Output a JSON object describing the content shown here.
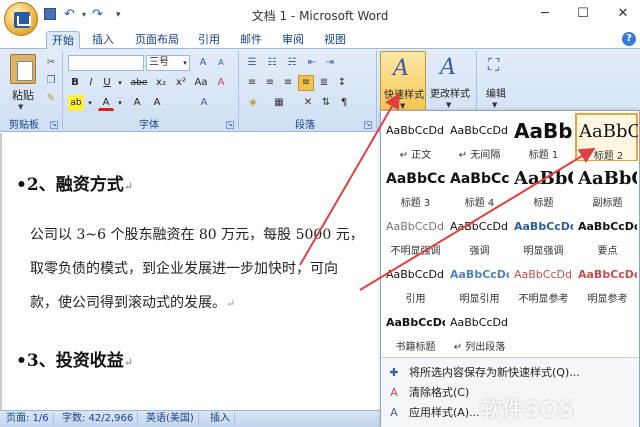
{
  "window": {
    "title": "文档 1 - Microsoft Word",
    "min": "─",
    "max": "☐",
    "close": "✕"
  },
  "qat": {
    "undo": "↶",
    "redo": "↷",
    "more": "▾",
    "undo_dd": "▾"
  },
  "tabs": [
    "开始",
    "插入",
    "页面布局",
    "引用",
    "邮件",
    "审阅",
    "视图"
  ],
  "ribbon": {
    "clipboard": {
      "label": "剪贴板",
      "paste": "粘贴"
    },
    "font": {
      "label": "字体",
      "font_name": "",
      "font_size": "三号",
      "bold": "B",
      "italic": "I",
      "underline": "U",
      "strike": "abe",
      "sub": "x₂",
      "sup": "x²",
      "aa": "Aa",
      "clear": "A",
      "grow": "A",
      "shrink": "A",
      "size_dd": "▾",
      "wen": "A"
    },
    "paragraph": {
      "label": "段落"
    },
    "styles": {
      "quick_styles": "快速样式",
      "change_styles": "更改样式"
    },
    "editing": {
      "label": "编辑"
    }
  },
  "document": {
    "heading2": "•2、融资方式",
    "para1": "公司以 3~6 个股东融资在 80 万元，每股 5000 元，",
    "para2": "取零负债的模式，到企业发展进一步加快时，可向",
    "para3": "款，使公司得到滚动式的发展。",
    "heading3": "•3、投资收益",
    "pilcrow": "↵"
  },
  "status": {
    "page": "页面: 1/6",
    "words": "字数: 42/2,966",
    "lang": "英语(美国)",
    "mode": "插入"
  },
  "gallery": {
    "styles": [
      {
        "preview": "AaBbCcDd",
        "name": "↵ 正文",
        "size": 11,
        "weight": "normal",
        "color": "#111"
      },
      {
        "preview": "AaBbCcDd",
        "name": "↵ 无间隔",
        "size": 11,
        "weight": "normal",
        "color": "#111"
      },
      {
        "preview": "AaBb",
        "name": "标题 1",
        "size": 20,
        "weight": "bold",
        "color": "#111"
      },
      {
        "preview": "AaBbC",
        "name": "标题 2",
        "size": 18,
        "weight": "normal",
        "color": "#111"
      },
      {
        "preview": "AaBbCc",
        "name": "标题 3",
        "size": 14,
        "weight": "bold",
        "color": "#111"
      },
      {
        "preview": "AaBbCc",
        "name": "标题 4",
        "size": 14,
        "weight": "bold",
        "color": "#111"
      },
      {
        "preview": "AaBbC",
        "name": "标题",
        "size": 18,
        "weight": "bold",
        "color": "#111"
      },
      {
        "preview": "AaBbC",
        "name": "副标题",
        "size": 18,
        "weight": "bold",
        "color": "#111"
      },
      {
        "preview": "AaBbCcDd",
        "name": "不明显强调",
        "size": 11,
        "weight": "normal",
        "color": "#777"
      },
      {
        "preview": "AaBbCcDd",
        "name": "强调",
        "size": 11,
        "weight": "normal",
        "color": "#111"
      },
      {
        "preview": "AaBbCcDd",
        "name": "明显强调",
        "size": 11,
        "weight": "bold",
        "color": "#2e5d9f"
      },
      {
        "preview": "AaBbCcDc",
        "name": "要点",
        "size": 11,
        "weight": "bold",
        "color": "#111"
      },
      {
        "preview": "AaBbCcDd",
        "name": "引用",
        "size": 11,
        "weight": "normal",
        "color": "#111"
      },
      {
        "preview": "AaBbCcDc",
        "name": "明显引用",
        "size": 11,
        "weight": "bold",
        "color": "#4f81bd"
      },
      {
        "preview": "AaBbCcDd",
        "name": "不明显参考",
        "size": 11,
        "weight": "normal",
        "color": "#c0504d"
      },
      {
        "preview": "AaBbCcDd",
        "name": "明显参考",
        "size": 11,
        "weight": "bold",
        "color": "#c0504d"
      },
      {
        "preview": "AaBbCcDd",
        "name": "书籍标题",
        "size": 11,
        "weight": "bold",
        "color": "#111"
      },
      {
        "preview": "AaBbCcDd",
        "name": "↵ 列出段落",
        "size": 11,
        "weight": "normal",
        "color": "#111"
      }
    ],
    "menu": [
      "将所选内容保存为新快速样式(Q)...",
      "清除格式(C)",
      "应用样式(A)..."
    ]
  },
  "watermark": "软件SOS",
  "colors": {
    "accent": "#f6c24c",
    "ribbon": "#dfeaf7",
    "arrow": "#e04040"
  }
}
